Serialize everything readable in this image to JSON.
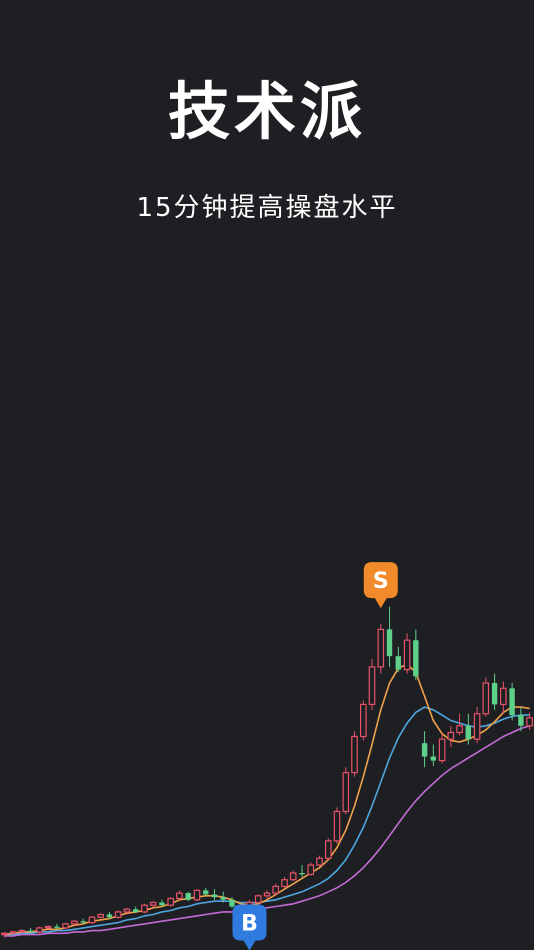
{
  "header": {
    "title": "技术派",
    "subtitle": "15分钟提高操盘水平"
  },
  "colors": {
    "background": "#1e1f22",
    "up": "#e8546a",
    "down": "#5fd08a",
    "ma_orange": "#f0a34a",
    "ma_blue": "#4fa6e0",
    "ma_purple": "#c26bd6",
    "marker_buy": "#2f7be0",
    "marker_sell": "#f08a2a"
  },
  "chart_data": {
    "type": "candlestick",
    "candles": [
      [
        10,
        10.2,
        9.8,
        10.1
      ],
      [
        10.1,
        10.3,
        10,
        10.2
      ],
      [
        10.2,
        10.4,
        10.1,
        10.3
      ],
      [
        10.3,
        10.5,
        10.2,
        10.2
      ],
      [
        10.2,
        10.6,
        10.1,
        10.5
      ],
      [
        10.5,
        10.7,
        10.4,
        10.6
      ],
      [
        10.6,
        10.8,
        10.4,
        10.5
      ],
      [
        10.5,
        10.9,
        10.4,
        10.8
      ],
      [
        10.8,
        11.1,
        10.7,
        11
      ],
      [
        11,
        11.2,
        10.8,
        10.9
      ],
      [
        10.9,
        11.4,
        10.8,
        11.3
      ],
      [
        11.3,
        11.6,
        11.2,
        11.5
      ],
      [
        11.5,
        11.7,
        11.2,
        11.3
      ],
      [
        11.3,
        11.8,
        11.2,
        11.7
      ],
      [
        11.7,
        12,
        11.6,
        11.9
      ],
      [
        11.9,
        12.1,
        11.6,
        11.7
      ],
      [
        11.7,
        12.3,
        11.6,
        12.2
      ],
      [
        12.2,
        12.5,
        12,
        12.4
      ],
      [
        12.4,
        12.6,
        12.1,
        12.2
      ],
      [
        12.2,
        12.8,
        12.1,
        12.7
      ],
      [
        12.7,
        13.3,
        12.6,
        13.1
      ],
      [
        13.1,
        13.2,
        12.5,
        12.6
      ],
      [
        12.6,
        13.4,
        12.5,
        13.3
      ],
      [
        13.3,
        13.5,
        12.9,
        13
      ],
      [
        13,
        13.4,
        12.6,
        12.8
      ],
      [
        12.8,
        13.2,
        12.4,
        12.6
      ],
      [
        12.6,
        12.8,
        12,
        12.1
      ],
      [
        12.1,
        12.3,
        11.5,
        11.6
      ],
      [
        11.6,
        12.6,
        11.5,
        12.4
      ],
      [
        12.4,
        13,
        12.3,
        12.9
      ],
      [
        12.9,
        13.3,
        12.7,
        13.1
      ],
      [
        13.1,
        13.8,
        13,
        13.6
      ],
      [
        13.6,
        14.3,
        13.5,
        14.1
      ],
      [
        14.1,
        14.8,
        14,
        14.6
      ],
      [
        14.6,
        15.2,
        14.3,
        14.5
      ],
      [
        14.5,
        15.4,
        14.4,
        15.2
      ],
      [
        15.2,
        15.9,
        15.1,
        15.7
      ],
      [
        15.7,
        17.2,
        15.6,
        17
      ],
      [
        17,
        19.5,
        16.8,
        19.2
      ],
      [
        19.2,
        22.5,
        19,
        22.1
      ],
      [
        22.1,
        25.2,
        21.8,
        24.8
      ],
      [
        24.8,
        27.5,
        24.5,
        27.2
      ],
      [
        27.2,
        30.6,
        26.8,
        30
      ],
      [
        30,
        33.2,
        29.5,
        32.8
      ],
      [
        32.8,
        34.5,
        30,
        30.8
      ],
      [
        30.8,
        31.5,
        29.6,
        29.8
      ],
      [
        29.8,
        32.5,
        29.5,
        32
      ],
      [
        32,
        32.8,
        29,
        29.3
      ],
      [
        24.3,
        25.2,
        22.5,
        23.3
      ],
      [
        23.3,
        24.2,
        22.6,
        23
      ],
      [
        23,
        25,
        22.8,
        24.6
      ],
      [
        24.6,
        25.6,
        24,
        25.1
      ],
      [
        25.1,
        26.5,
        24.9,
        25.6
      ],
      [
        25.6,
        26.5,
        24.2,
        24.6
      ],
      [
        24.6,
        27,
        24.3,
        26.5
      ],
      [
        26.5,
        29.2,
        26.3,
        28.8
      ],
      [
        28.8,
        29.5,
        26.8,
        27.2
      ],
      [
        27.2,
        28.9,
        26.5,
        28.4
      ],
      [
        28.4,
        28.8,
        26,
        26.4
      ],
      [
        26.4,
        27,
        25.2,
        25.6
      ],
      [
        25.6,
        26.6,
        25.3,
        26.2
      ]
    ],
    "ma_orange": [
      10,
      10.1,
      10.2,
      10.2,
      10.3,
      10.4,
      10.4,
      10.5,
      10.7,
      10.8,
      11,
      11.1,
      11.2,
      11.4,
      11.6,
      11.7,
      11.8,
      12,
      12.1,
      12.3,
      12.6,
      12.7,
      12.8,
      12.9,
      12.9,
      12.8,
      12.6,
      12.3,
      12.2,
      12.3,
      12.6,
      13,
      13.4,
      13.8,
      14.2,
      14.6,
      15,
      15.6,
      16.5,
      17.8,
      19.6,
      21.8,
      24.2,
      26.8,
      28.8,
      29.9,
      30.2,
      29.6,
      27.8,
      26,
      25,
      24.5,
      24.4,
      24.6,
      24.9,
      25.3,
      25.9,
      26.6,
      27,
      27,
      26.9
    ],
    "ma_blue": [
      10,
      10,
      10.1,
      10.1,
      10.2,
      10.2,
      10.3,
      10.3,
      10.4,
      10.5,
      10.6,
      10.7,
      10.8,
      10.9,
      11.1,
      11.2,
      11.4,
      11.5,
      11.7,
      11.8,
      12,
      12.1,
      12.3,
      12.4,
      12.5,
      12.5,
      12.5,
      12.4,
      12.4,
      12.4,
      12.5,
      12.6,
      12.8,
      13,
      13.2,
      13.5,
      13.8,
      14.2,
      14.8,
      15.6,
      16.7,
      18,
      19.6,
      21.4,
      23.2,
      24.7,
      25.8,
      26.6,
      27,
      26.8,
      26.4,
      26,
      25.8,
      25.6,
      25.5,
      25.6,
      25.8,
      26.1,
      26.3,
      26.4,
      26.4
    ],
    "ma_purple": [
      9.9,
      9.9,
      10,
      10,
      10,
      10.1,
      10.1,
      10.1,
      10.2,
      10.2,
      10.3,
      10.3,
      10.4,
      10.5,
      10.6,
      10.7,
      10.8,
      10.9,
      11,
      11.1,
      11.2,
      11.3,
      11.4,
      11.5,
      11.6,
      11.7,
      11.7,
      11.8,
      11.8,
      11.9,
      12,
      12.1,
      12.2,
      12.3,
      12.5,
      12.7,
      12.9,
      13.2,
      13.5,
      13.9,
      14.4,
      15,
      15.7,
      16.5,
      17.4,
      18.3,
      19.2,
      20,
      20.7,
      21.3,
      21.9,
      22.4,
      22.8,
      23.2,
      23.6,
      24,
      24.4,
      24.8,
      25.1,
      25.4,
      25.6
    ],
    "buy_index": 28,
    "sell_index": 43,
    "buy_label": "B",
    "sell_label": "S"
  }
}
